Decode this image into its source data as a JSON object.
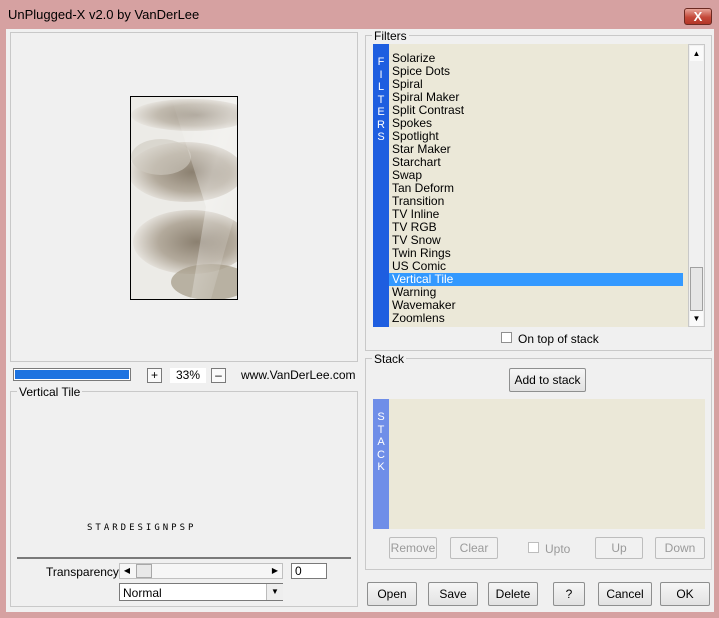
{
  "window": {
    "title": "UnPlugged-X v2.0 by VanDerLee",
    "close_glyph": "X"
  },
  "preview": {
    "progress_fraction": 1.0,
    "zoom_in_label": "+",
    "zoom_value": "33%",
    "zoom_out_label": "–",
    "website": "www.VanDerLee.com"
  },
  "effect_panel": {
    "title": "Vertical Tile",
    "watermark": "STARDESIGNPSP",
    "transparency_label": "Transparency",
    "transparency_value": "0",
    "blend_mode": "Normal"
  },
  "filters": {
    "group_title": "Filters",
    "side_letters": [
      "F",
      "I",
      "L",
      "T",
      "E",
      "R",
      "S"
    ],
    "items": [
      "Solarize",
      "Spice Dots",
      "Spiral",
      "Spiral Maker",
      "Split Contrast",
      "Spokes",
      "Spotlight",
      "Star Maker",
      "Starchart",
      "Swap",
      "Tan Deform",
      "Transition",
      "TV Inline",
      "TV RGB",
      "TV Snow",
      "Twin Rings",
      "US Comic",
      "Vertical Tile",
      "Warning",
      "Wavemaker",
      "Zoomlens"
    ],
    "selected": "Vertical Tile",
    "on_top_label": "On top of stack"
  },
  "stack": {
    "group_title": "Stack",
    "add_label": "Add to stack",
    "side_letters": [
      "S",
      "T",
      "A",
      "C",
      "K"
    ],
    "remove_label": "Remove",
    "clear_label": "Clear",
    "upto_label": "Upto",
    "up_label": "Up",
    "down_label": "Down"
  },
  "buttons": {
    "open": "Open",
    "save": "Save",
    "delete": "Delete",
    "help": "?",
    "cancel": "Cancel",
    "ok": "OK"
  },
  "colors": {
    "frame": "#d6a1a1",
    "accent_blue": "#1e5ee0",
    "selection": "#3399ff",
    "list_bg": "#ebe8d8"
  }
}
